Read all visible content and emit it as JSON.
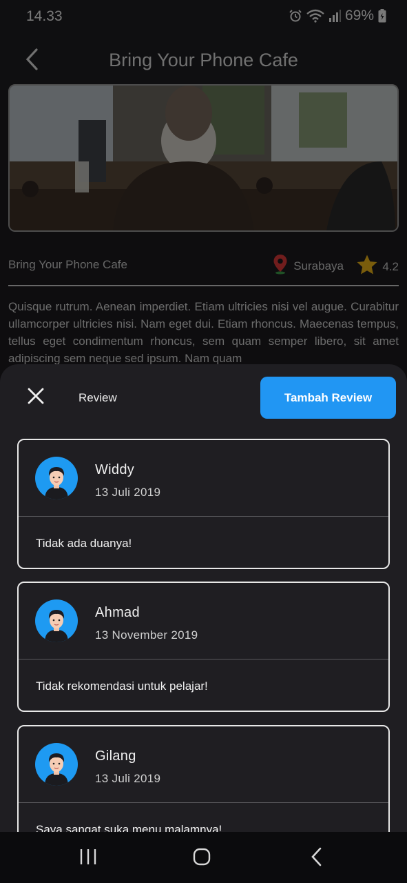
{
  "status_bar": {
    "time": "14.33",
    "battery": "69%",
    "icons": [
      "alarm-icon",
      "wifi-icon",
      "signal-icon",
      "battery-icon"
    ]
  },
  "app_bar": {
    "title": "Bring Your Phone Cafe",
    "back_icon": "chevron-left-icon"
  },
  "cafe": {
    "name": "Bring Your Phone Cafe",
    "location": "Surabaya",
    "rating": "4.2",
    "description": "Quisque rutrum. Aenean imperdiet. Etiam ultricies nisi vel augue. Curabitur ullamcorper ultricies nisi. Nam eget dui. Etiam rhoncus. Maecenas tempus, tellus eget condimentum rhoncus, sem quam semper libero, sit amet adipiscing sem neque sed ipsum. Nam quam"
  },
  "sheet": {
    "title": "Review",
    "add_button": "Tambah Review"
  },
  "reviews": [
    {
      "name": "Widdy",
      "date": "13 Juli 2019",
      "text": "Tidak ada duanya!"
    },
    {
      "name": "Ahmad",
      "date": "13 November 2019",
      "text": "Tidak rekomendasi untuk pelajar!"
    },
    {
      "name": "Gilang",
      "date": "13 Juli 2019",
      "text": "Saya sangat suka menu malamnya!"
    }
  ],
  "colors": {
    "accent": "#2196f3",
    "background": "#1f1e22",
    "avatar_bg": "#1e9af2"
  }
}
